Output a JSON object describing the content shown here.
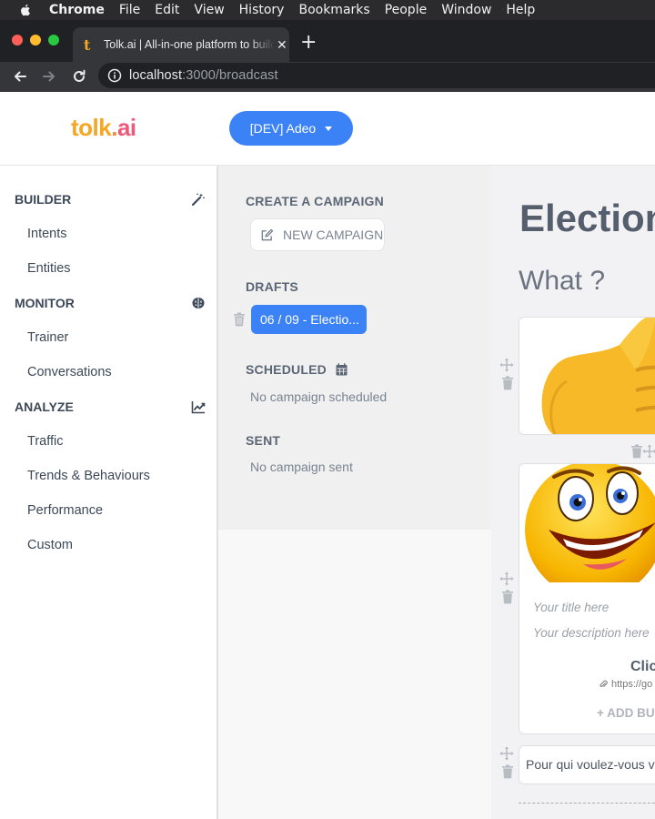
{
  "menubar": {
    "app": "Chrome",
    "items": [
      "File",
      "Edit",
      "View",
      "History",
      "Bookmarks",
      "People",
      "Window",
      "Help"
    ]
  },
  "browser": {
    "tab_title": "Tolk.ai | All-in-one platform to build",
    "tab_favicon": "t",
    "url_host": "localhost",
    "url_rest": ":3000/broadcast"
  },
  "header": {
    "logo_a": "tolk",
    "logo_dot": ".",
    "logo_b": "ai",
    "env_button": "[DEV] Adeo"
  },
  "sidebar": {
    "builder": "BUILDER",
    "monitor": "MONITOR",
    "analyze": "ANALYZE",
    "builder_items": [
      "Intents",
      "Entities"
    ],
    "monitor_items": [
      "Trainer",
      "Conversations"
    ],
    "analyze_items": [
      "Traffic",
      "Trends & Behaviours",
      "Performance",
      "Custom"
    ]
  },
  "campaigns": {
    "create_label": "CREATE A CAMPAIGN",
    "new_campaign": "NEW CAMPAIGN",
    "drafts_label": "DRAFTS",
    "draft_item": "06 / 09 - Electio...",
    "scheduled_label": "SCHEDULED",
    "scheduled_empty": "No campaign scheduled",
    "sent_label": "SENT",
    "sent_empty": "No campaign sent"
  },
  "editor": {
    "campaign_title": "Election",
    "question": "What ?",
    "card_title_placeholder": "Your title here",
    "card_description_placeholder": "Your description here",
    "button_title": "Clic",
    "button_link": "https://go",
    "add_button": "+ ADD BU",
    "text_block": "Pour qui voulez-vous v"
  },
  "colors": {
    "accent": "#3b82f6",
    "logo_orange": "#f5a623",
    "logo_pink": "#ee5a7a"
  },
  "icons": {
    "builder": "magic-wand-icon",
    "monitor": "brain-icon",
    "analyze": "line-chart-icon",
    "new_campaign": "edit-icon",
    "scheduled": "calendar-icon",
    "delete": "trash-icon",
    "move": "move-icon"
  }
}
